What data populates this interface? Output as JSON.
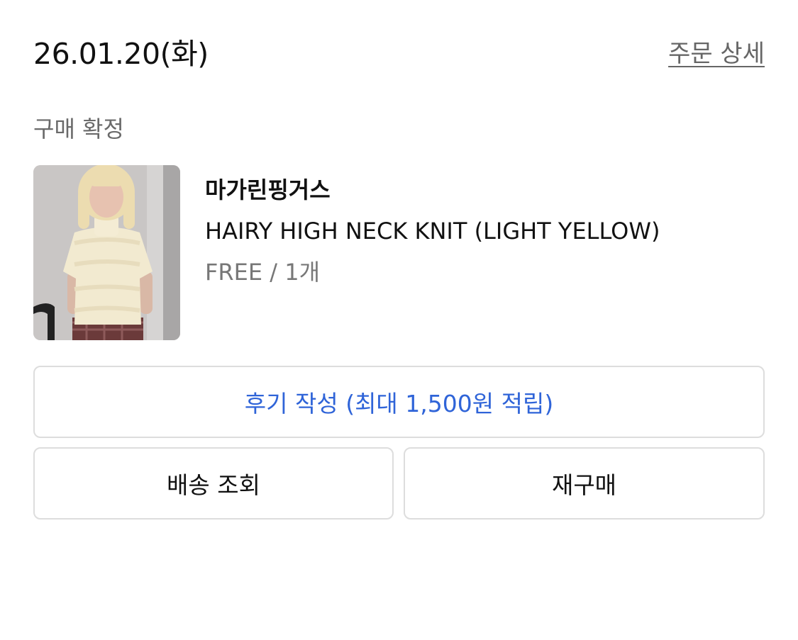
{
  "order": {
    "date": "26.01.20(화)",
    "detail_link": "주문 상세",
    "status": "구매 확정"
  },
  "product": {
    "brand": "마가린핑거스",
    "name": "HAIRY HIGH NECK KNIT (LIGHT YELLOW)",
    "option": "FREE / 1개",
    "image_icon": "product-photo"
  },
  "actions": {
    "review_label": "후기 작성 (최대 1,500원 적립)",
    "track_label": "배송 조회",
    "rebuy_label": "재구매"
  },
  "colors": {
    "accent": "#2f64d8",
    "border": "#dddddd",
    "muted_text": "#777777"
  }
}
